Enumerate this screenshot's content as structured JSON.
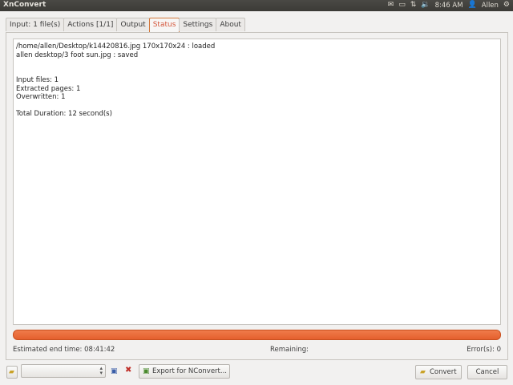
{
  "app": {
    "title": "XnConvert"
  },
  "topbar": {
    "time": "8:46 AM",
    "user": "Allen",
    "icons": [
      "mail-icon",
      "battery-icon",
      "network-icon",
      "volume-icon",
      "user-icon",
      "gear-icon"
    ]
  },
  "tabs": [
    {
      "label": "Input: 1 file(s)"
    },
    {
      "label": "Actions [1/1]"
    },
    {
      "label": "Output"
    },
    {
      "label": "Status"
    },
    {
      "label": "Settings"
    },
    {
      "label": "About"
    }
  ],
  "status": {
    "log": [
      "/home/allen/Desktop/k14420816.jpg 170x170x24 : loaded",
      "allen desktop/3 foot sun.jpg : saved",
      "",
      "",
      "Input files: 1",
      "Extracted pages: 1",
      "Overwritten: 1",
      "",
      "Total Duration: 12 second(s)"
    ],
    "progress": 1.0,
    "progress_color": "#e8632f",
    "estimated_end": "Estimated end time:  08:41:42",
    "remaining": "Remaining:",
    "errors": "Error(s):  0"
  },
  "bottom": {
    "export_label": "Export for NConvert...",
    "convert_label": "Convert",
    "cancel_label": "Cancel"
  }
}
